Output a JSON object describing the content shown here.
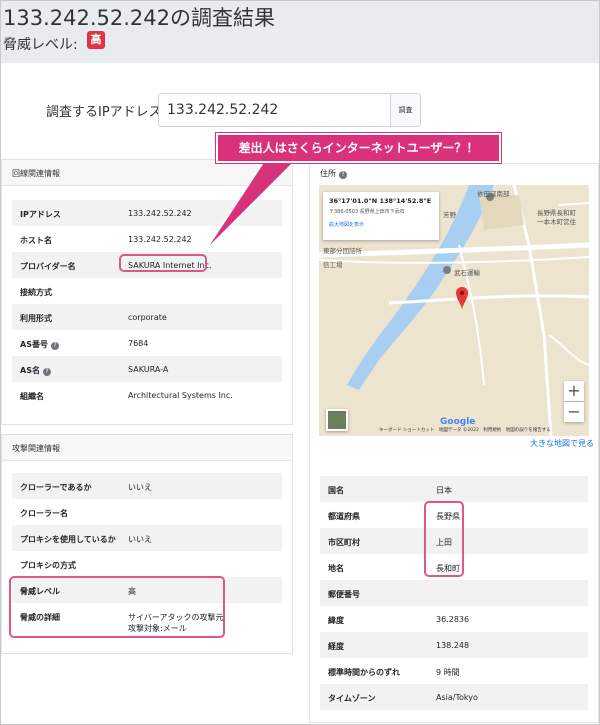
{
  "header": {
    "title": "133.242.52.242の調査結果",
    "threat_label": "脅威レベル:",
    "threat_badge": "高"
  },
  "search": {
    "label": "調査するIPアドレス",
    "value": "133.242.52.242",
    "button": "調査"
  },
  "callout": {
    "text": "差出人はさくらインターネットユーザー？！"
  },
  "network_card": {
    "title": "回線関連情報",
    "rows": [
      {
        "key": "IPアドレス",
        "value": "133.242.52.242"
      },
      {
        "key": "ホスト名",
        "value": "133.242.52.242"
      },
      {
        "key": "プロバイダー名",
        "value": "SAKURA Internet Inc."
      },
      {
        "key": "接続方式",
        "value": ""
      },
      {
        "key": "利用形式",
        "value": "corporate"
      },
      {
        "key": "AS番号",
        "value": "7684"
      },
      {
        "key": "AS名",
        "value": "SAKURA-A"
      },
      {
        "key": "組織名",
        "value": "Architectural Systems Inc."
      }
    ]
  },
  "attack_card": {
    "title": "攻撃関連情報",
    "rows": [
      {
        "key": "クローラーであるか",
        "value": "いいえ"
      },
      {
        "key": "クローラー名",
        "value": ""
      },
      {
        "key": "プロキシを使用しているか",
        "value": "いいえ"
      },
      {
        "key": "プロキシの方式",
        "value": ""
      },
      {
        "key": "脅威レベル",
        "value": "高"
      },
      {
        "key": "脅威の詳細",
        "value": "サイバーアタックの攻撃元",
        "value2": "攻撃対象:メール"
      }
    ]
  },
  "address_card": {
    "title": "住所",
    "map": {
      "coords": "36°17'01.0\"N 138°14'52.8\"E",
      "address": "〒386-0503 長野県上田市下武石",
      "link": "拡大地図を表示",
      "labels": [
        "長野県長和町",
        "一本木町営住",
        "依田窪南部",
        "武石運輸",
        "東部分団詰所",
        "信工場",
        "芳野"
      ],
      "footer": "キーボード ショートカット　地図データ ©2022　利用規約　地図の誤りを報告する",
      "google": "Google",
      "zoom_in": "+",
      "zoom_out": "−"
    },
    "bigger_map_link": "大きな地図で見る",
    "rows": [
      {
        "key": "国名",
        "value": "日本"
      },
      {
        "key": "都道府県",
        "value": "長野県"
      },
      {
        "key": "市区町村",
        "value": "上田"
      },
      {
        "key": "地名",
        "value": "長和町"
      },
      {
        "key": "郵便番号",
        "value": ""
      },
      {
        "key": "緯度",
        "value": "36.2836"
      },
      {
        "key": "経度",
        "value": "138.248"
      },
      {
        "key": "標準時間からのずれ",
        "value": "9 時間"
      },
      {
        "key": "タイムゾーン",
        "value": "Asia/Tokyo"
      }
    ]
  },
  "colors": {
    "highlight": "#e0558a",
    "callout": "#d9317a",
    "badge": "#dc3545",
    "link": "#1a73e8"
  }
}
